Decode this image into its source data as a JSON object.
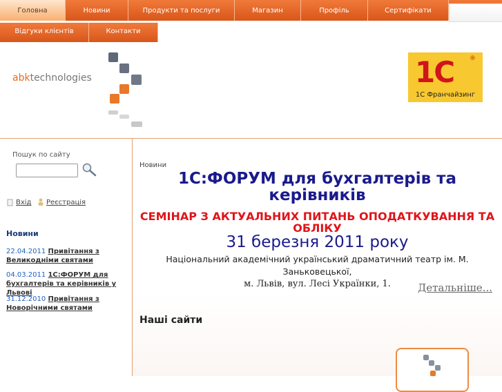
{
  "nav": {
    "row1": [
      "Головна",
      "Новини",
      "Продукти та послуги",
      "Магазин",
      "Профіль",
      "Сертифікати"
    ],
    "row2": [
      "Відгуки клієнтів",
      "Контакти"
    ]
  },
  "header": {
    "logo_abk": "abk",
    "logo_rest": "technologies",
    "badge_big": "1С",
    "badge_reg": "®",
    "badge_sub": "1С Франчайзинг"
  },
  "sidebar": {
    "search_label": "Пошук по сайту",
    "login": "Вхід",
    "register": "Реєстрація",
    "news_title": "Новини",
    "news": [
      {
        "date": "22.04.2011",
        "title": "Привітання з Великодніми святами"
      },
      {
        "date": "04.03.2011",
        "title": "1С:ФОРУМ для бухгалтерів та керівників у Львові"
      },
      {
        "date": "31.12.2010",
        "title": "Привітання з Новорічними святами"
      }
    ]
  },
  "main": {
    "breadcrumb": "Новини",
    "title": "1С:ФОРУМ  для бухгалтерів та керівників",
    "seminar": "СЕМІНАР З АКТУАЛЬНИХ ПИТАНЬ ОПОДАТКУВАННЯ ТА ОБЛІКУ",
    "date": "31 березня 2011 року",
    "venue_line1": "Національний академічний український драматичний театр ім. М. Заньковецької,",
    "venue_line2": "м. Львів, вул. Лесі Українки, 1.",
    "more": "Детальніше...",
    "our_sites": "Наші сайти"
  }
}
